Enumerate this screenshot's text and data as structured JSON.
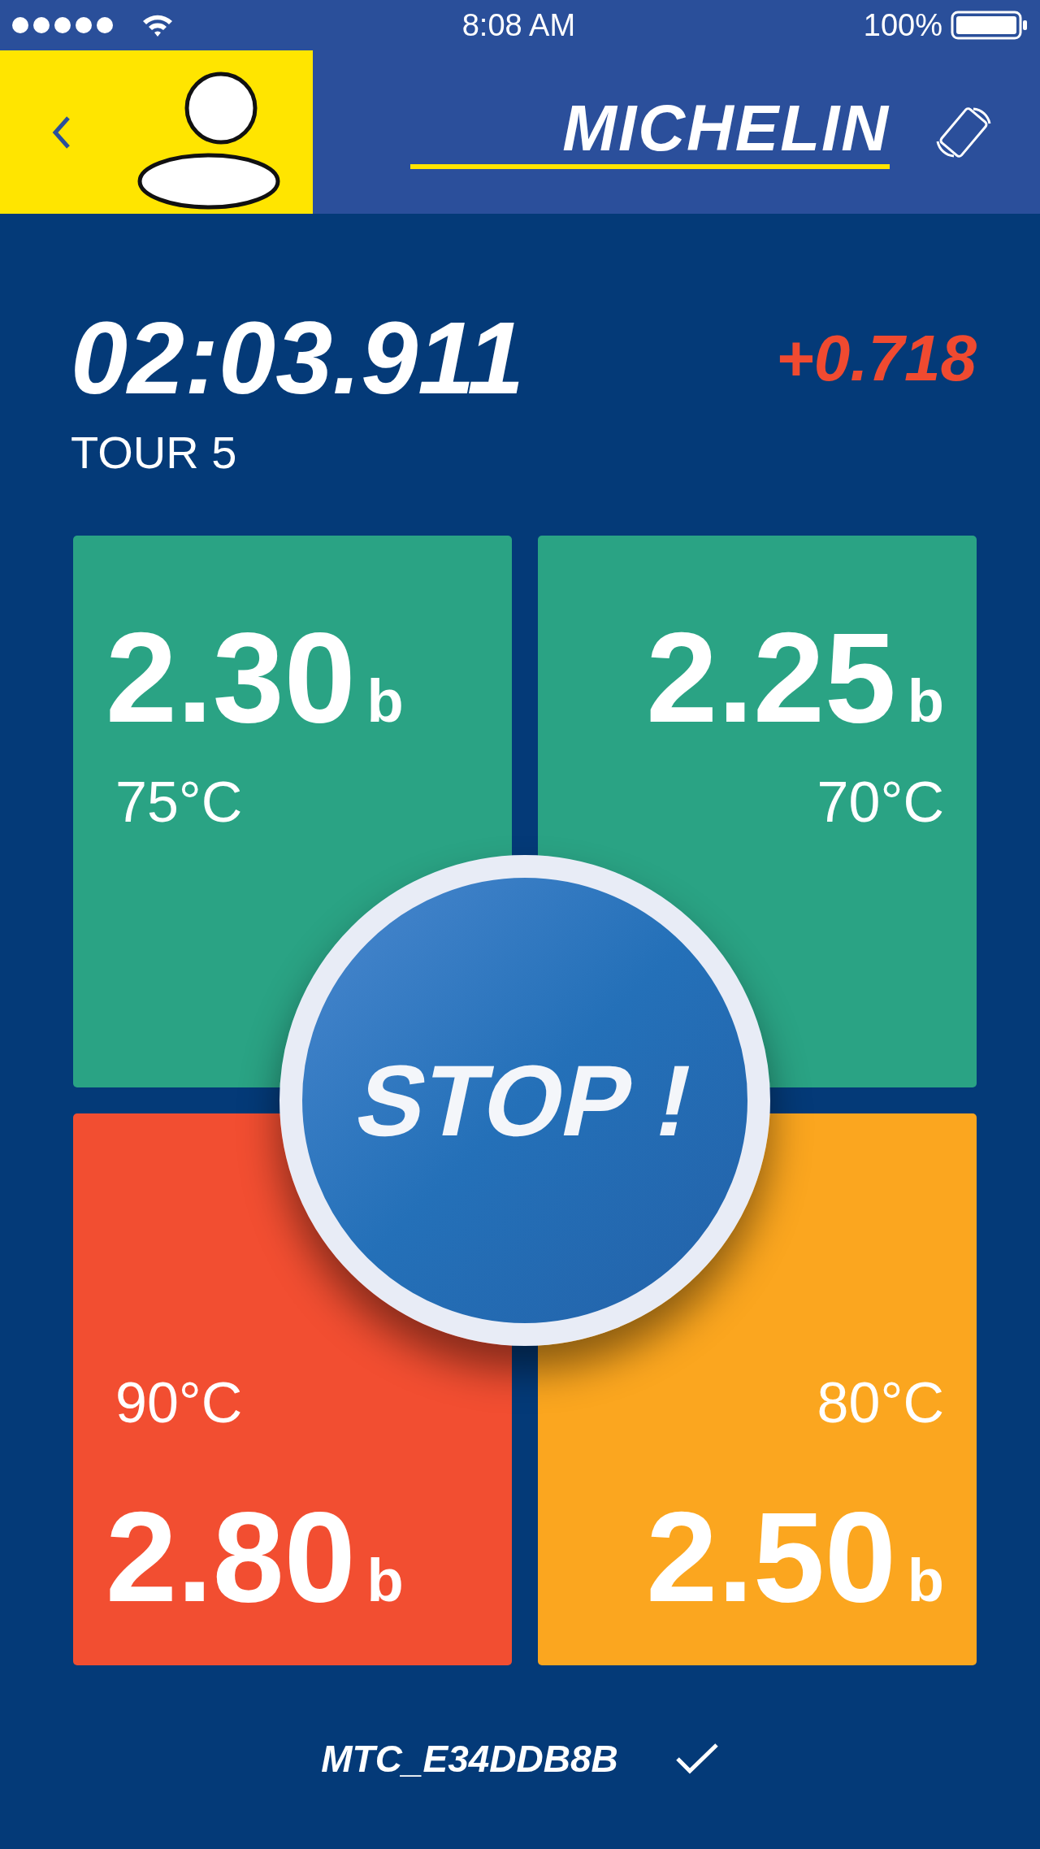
{
  "status_bar": {
    "time": "8:08 AM",
    "battery": "100%"
  },
  "header": {
    "brand": "MICHELIN"
  },
  "lap": {
    "time": "02:03.911",
    "delta": "+0.718",
    "label": "TOUR 5"
  },
  "tires": [
    {
      "pressure": "2.30",
      "unit": "b",
      "temperature": "75°C",
      "color": "#2aa384"
    },
    {
      "pressure": "2.25",
      "unit": "b",
      "temperature": "70°C",
      "color": "#2aa384"
    },
    {
      "pressure": "2.80",
      "unit": "b",
      "temperature": "90°C",
      "color": "#f24e31"
    },
    {
      "pressure": "2.50",
      "unit": "b",
      "temperature": "80°C",
      "color": "#fba61f"
    }
  ],
  "stop_button": {
    "label": "STOP !"
  },
  "device": {
    "name": "MTC_E34DDB8B",
    "connected": true
  }
}
